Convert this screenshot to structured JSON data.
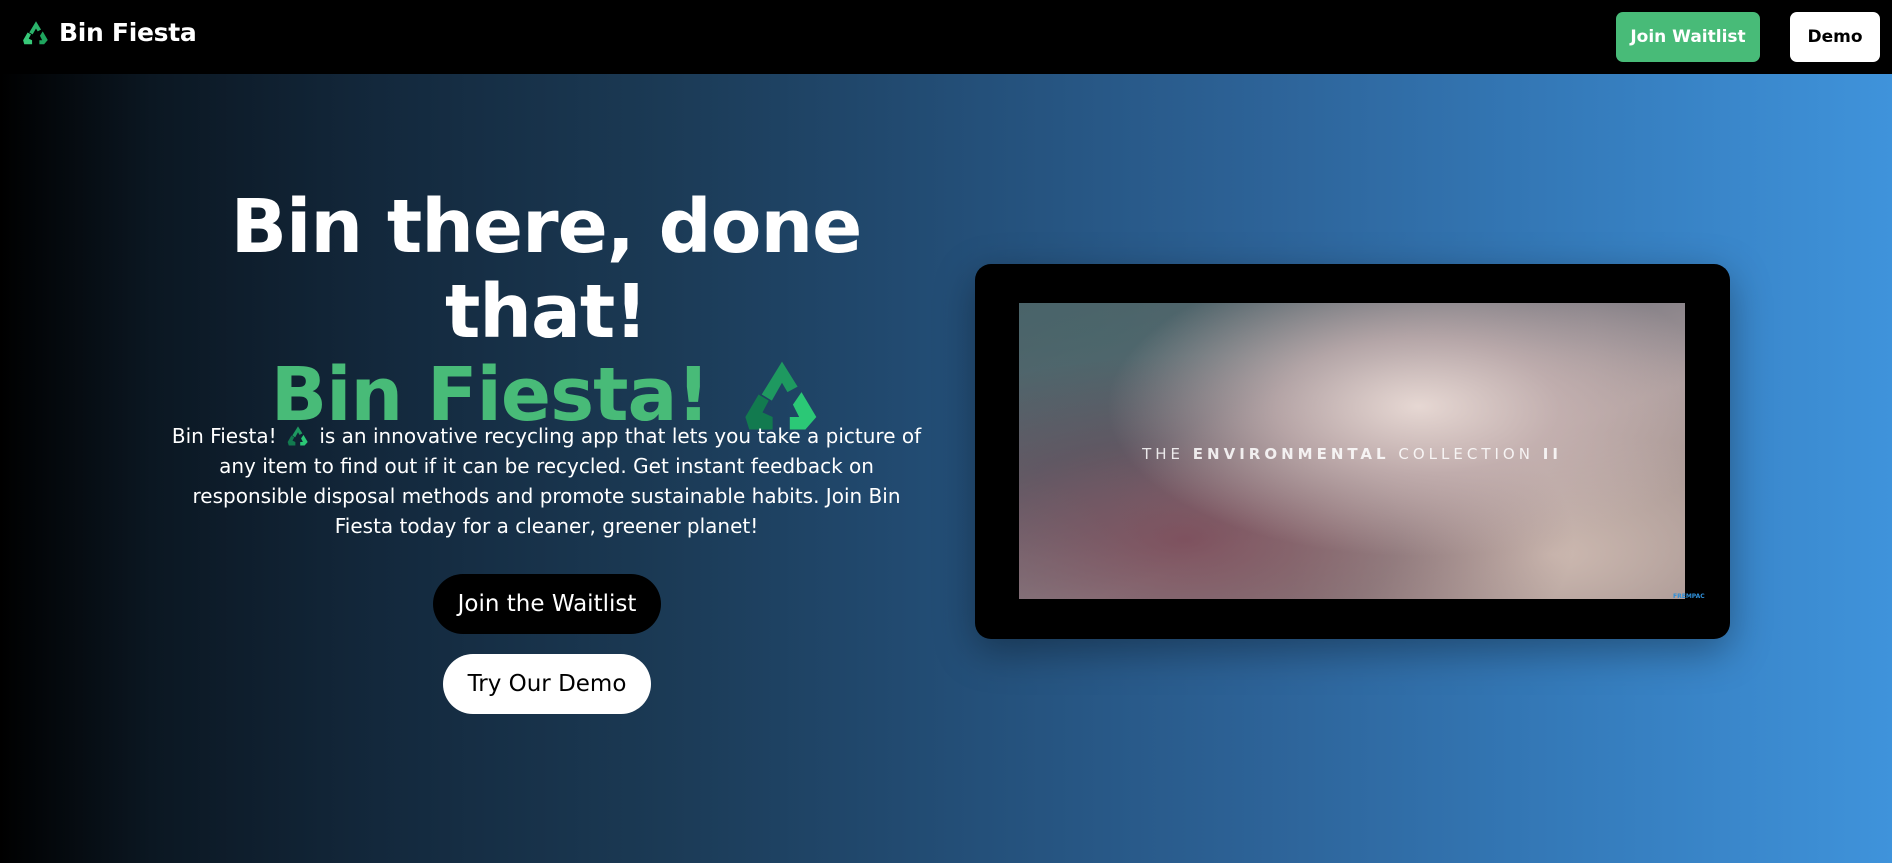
{
  "header": {
    "brand_name": "Bin Fiesta",
    "brand_icon": "recycle-icon",
    "join_waitlist_label": "Join Waitlist",
    "demo_label": "Demo"
  },
  "hero": {
    "title_line1": "Bin there, done that!",
    "title_line2": "Bin Fiesta!",
    "title_icon": "recycle-icon",
    "description_prefix": "Bin Fiesta!",
    "description_body": "is an innovative recycling app that lets you take a picture of any item to find out if it can be recycled. Get instant feedback on responsible disposal methods and promote sustainable habits. Join Bin Fiesta today for a cleaner, greener planet!",
    "cta_waitlist_label": "Join the Waitlist",
    "cta_demo_label": "Try Our Demo"
  },
  "video": {
    "caption_part1": "THE",
    "caption_part2": "ENVIRONMENTAL",
    "caption_part3": "COLLECTION",
    "caption_part4": "II",
    "watermark": "FREMPAC"
  },
  "colors": {
    "accent_green": "#48bb78",
    "header_bg": "#000000",
    "gradient_start": "#000000",
    "gradient_end": "#3f93db"
  }
}
